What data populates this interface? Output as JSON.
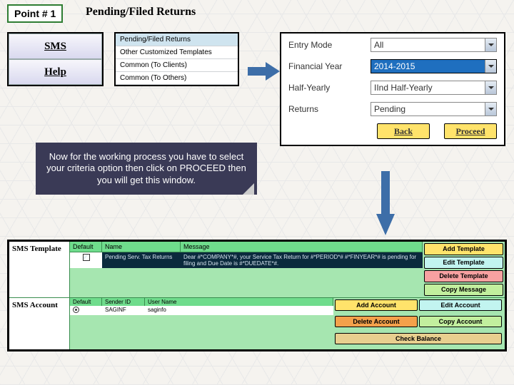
{
  "header": {
    "point_tag": "Point # 1",
    "title": "Pending/Filed Returns"
  },
  "nav": {
    "sms": "SMS",
    "help": "Help"
  },
  "menu": {
    "items": [
      "Pending/Filed Returns",
      "Other Customized Templates",
      "Common (To Clients)",
      "Common (To Others)"
    ]
  },
  "params": {
    "entry_mode": {
      "label": "Entry Mode",
      "value": "All"
    },
    "fin_year": {
      "label": "Financial Year",
      "value": "2014-2015"
    },
    "half_yearly": {
      "label": "Half-Yearly",
      "value": "IInd Half-Yearly"
    },
    "returns": {
      "label": "Returns",
      "value": "Pending"
    },
    "back": "Back",
    "proceed": "Proceed"
  },
  "note": "Now for the working process you have to select your criteria option then click on PROCEED then you will get this window.",
  "template": {
    "left_tpl": "SMS Template",
    "left_acct": "SMS Account",
    "cols": {
      "def": "Default",
      "name": "Name",
      "msg": "Message"
    },
    "row": {
      "name": "Pending Serv. Tax Returns",
      "msg": "Dear #*COMPANY*#, your Service Tax Return for #*PERIOD*# #*FINYEAR*# is pending for filing and Due Date is #*DUEDATE*#."
    },
    "actions": {
      "add_tpl": "Add Template",
      "edit_tpl": "Edit Template",
      "del_tpl": "Delete Template",
      "copy_msg": "Copy Message",
      "add_acct": "Add Account",
      "edit_acct": "Edit Account",
      "del_acct": "Delete Account",
      "copy_acct": "Copy Account",
      "check_bal": "Check Balance"
    },
    "acct_cols": {
      "def": "Default",
      "sid": "Sender ID",
      "un": "User Name"
    },
    "acct_row": {
      "sid": "SAGINF",
      "un": "saginfo"
    }
  }
}
